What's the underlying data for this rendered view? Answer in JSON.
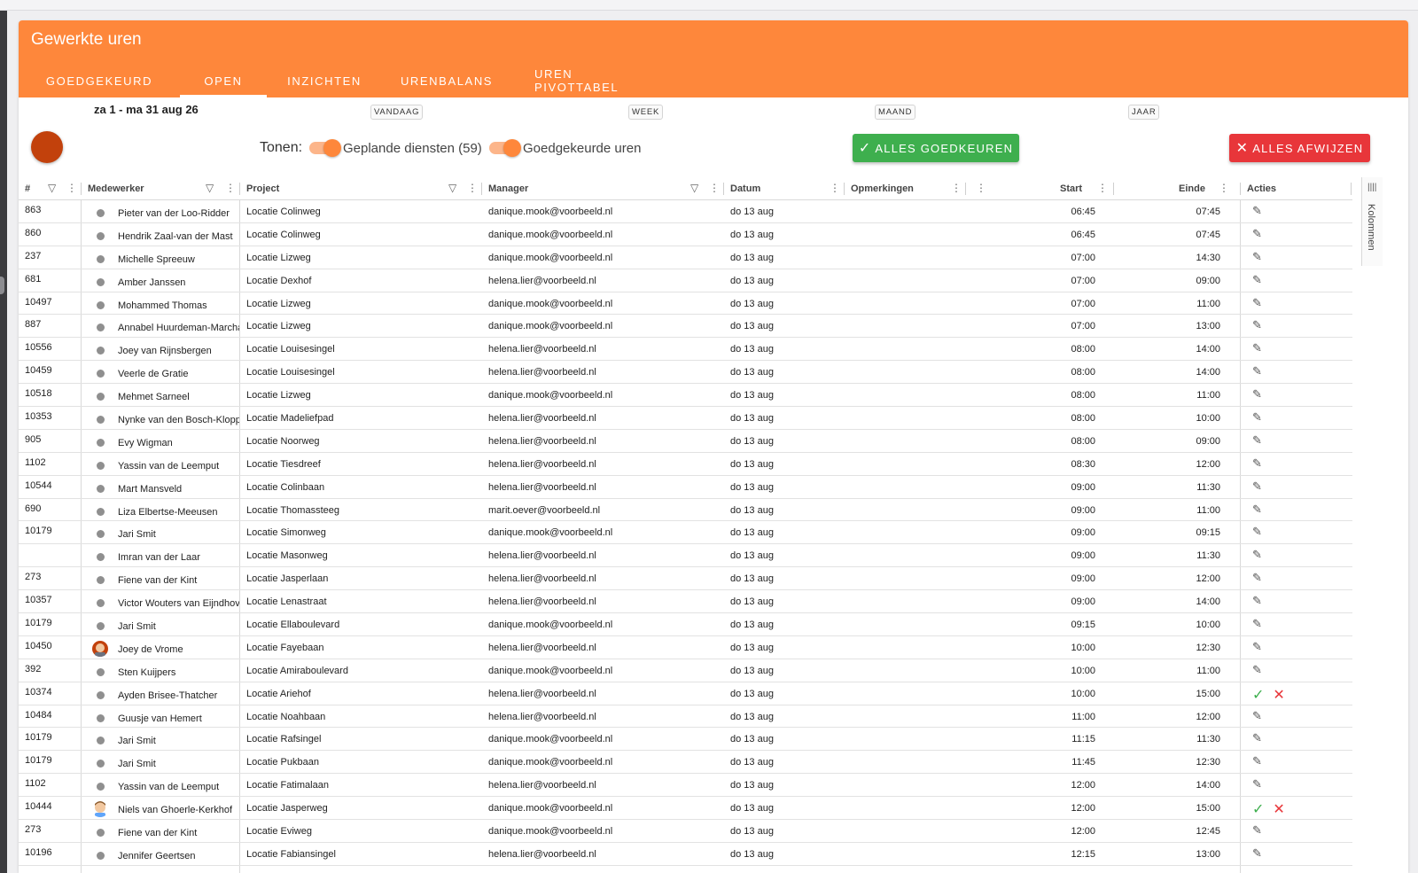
{
  "header": {
    "title": "Gewerkte uren",
    "tabs": [
      "GOEDGEKEURD",
      "OPEN",
      "INZICHTEN",
      "URENBALANS",
      "UREN PIVOTTABEL"
    ],
    "active_tab": "OPEN"
  },
  "range": {
    "label": "za 1 - ma 31 aug 26",
    "periods": [
      "VANDAAG",
      "WEEK",
      "MAAND",
      "JAAR"
    ]
  },
  "toolbar": {
    "tonen": "Tonen:",
    "toggle1": "Geplande diensten (59)",
    "toggle2": "Goedgekeurde uren",
    "approve_all": "ALLES GOEDKEUREN",
    "reject_all": "ALLES AFWIJZEN",
    "approve_icon": "✓",
    "reject_icon": "✕"
  },
  "columns": {
    "id": "#",
    "employee": "Medewerker",
    "project": "Project",
    "manager": "Manager",
    "date": "Datum",
    "remarks": "Opmerkingen",
    "start": "Start",
    "end": "Einde",
    "actions": "Acties"
  },
  "side_panel": {
    "label": "Kolommen",
    "icon": "||||"
  },
  "icons": {
    "edit": "✎",
    "approve": "✓",
    "reject": "✕"
  },
  "rows": [
    {
      "id": "863",
      "name": "Pieter van der Loo-Ridder",
      "project": "Locatie Colinweg",
      "manager": "danique.mook@voorbeeld.nl",
      "date": "do 13 aug",
      "start": "06:45",
      "end": "07:45",
      "avatar": "dot",
      "actions": "edit"
    },
    {
      "id": "860",
      "name": "Hendrik Zaal-van der Mast",
      "project": "Locatie Colinweg",
      "manager": "danique.mook@voorbeeld.nl",
      "date": "do 13 aug",
      "start": "06:45",
      "end": "07:45",
      "avatar": "dot",
      "actions": "edit"
    },
    {
      "id": "237",
      "name": "Michelle Spreeuw",
      "project": "Locatie Lizweg",
      "manager": "danique.mook@voorbeeld.nl",
      "date": "do 13 aug",
      "start": "07:00",
      "end": "14:30",
      "avatar": "dot",
      "actions": "edit"
    },
    {
      "id": "681",
      "name": "Amber Janssen",
      "project": "Locatie Dexhof",
      "manager": "helena.lier@voorbeeld.nl",
      "date": "do 13 aug",
      "start": "07:00",
      "end": "09:00",
      "avatar": "dot",
      "actions": "edit"
    },
    {
      "id": "10497",
      "name": "Mohammed Thomas",
      "project": "Locatie Lizweg",
      "manager": "danique.mook@voorbeeld.nl",
      "date": "do 13 aug",
      "start": "07:00",
      "end": "11:00",
      "avatar": "dot",
      "actions": "edit"
    },
    {
      "id": "887",
      "name": "Annabel Huurdeman-Marcha",
      "project": "Locatie Lizweg",
      "manager": "danique.mook@voorbeeld.nl",
      "date": "do 13 aug",
      "start": "07:00",
      "end": "13:00",
      "avatar": "dot",
      "actions": "edit"
    },
    {
      "id": "10556",
      "name": "Joey van Rijnsbergen",
      "project": "Locatie Louisesingel",
      "manager": "helena.lier@voorbeeld.nl",
      "date": "do 13 aug",
      "start": "08:00",
      "end": "14:00",
      "avatar": "dot",
      "actions": "edit"
    },
    {
      "id": "10459",
      "name": "Veerle de Gratie",
      "project": "Locatie Louisesingel",
      "manager": "helena.lier@voorbeeld.nl",
      "date": "do 13 aug",
      "start": "08:00",
      "end": "14:00",
      "avatar": "dot",
      "actions": "edit"
    },
    {
      "id": "10518",
      "name": "Mehmet Sarneel",
      "project": "Locatie Lizweg",
      "manager": "danique.mook@voorbeeld.nl",
      "date": "do 13 aug",
      "start": "08:00",
      "end": "11:00",
      "avatar": "dot",
      "actions": "edit"
    },
    {
      "id": "10353",
      "name": "Nynke van den Bosch-Kloppe",
      "project": "Locatie Madeliefpad",
      "manager": "helena.lier@voorbeeld.nl",
      "date": "do 13 aug",
      "start": "08:00",
      "end": "10:00",
      "avatar": "dot",
      "actions": "edit"
    },
    {
      "id": "905",
      "name": "Evy Wigman",
      "project": "Locatie Noorweg",
      "manager": "helena.lier@voorbeeld.nl",
      "date": "do 13 aug",
      "start": "08:00",
      "end": "09:00",
      "avatar": "dot",
      "actions": "edit"
    },
    {
      "id": "1102",
      "name": "Yassin van de Leemput",
      "project": "Locatie Tiesdreef",
      "manager": "helena.lier@voorbeeld.nl",
      "date": "do 13 aug",
      "start": "08:30",
      "end": "12:00",
      "avatar": "dot",
      "actions": "edit"
    },
    {
      "id": "10544",
      "name": "Mart Mansveld",
      "project": "Locatie Colinbaan",
      "manager": "helena.lier@voorbeeld.nl",
      "date": "do 13 aug",
      "start": "09:00",
      "end": "11:30",
      "avatar": "dot",
      "actions": "edit"
    },
    {
      "id": "690",
      "name": "Liza Elbertse-Meeusen",
      "project": "Locatie Thomassteeg",
      "manager": "marit.oever@voorbeeld.nl",
      "date": "do 13 aug",
      "start": "09:00",
      "end": "11:00",
      "avatar": "dot",
      "actions": "edit"
    },
    {
      "id": "10179",
      "name": "Jari Smit",
      "project": "Locatie Simonweg",
      "manager": "danique.mook@voorbeeld.nl",
      "date": "do 13 aug",
      "start": "09:00",
      "end": "09:15",
      "avatar": "dot",
      "actions": "edit"
    },
    {
      "id": "",
      "name": "Imran van der Laar",
      "project": "Locatie Masonweg",
      "manager": "helena.lier@voorbeeld.nl",
      "date": "do 13 aug",
      "start": "09:00",
      "end": "11:30",
      "avatar": "dot",
      "actions": "edit"
    },
    {
      "id": "273",
      "name": "Fiene van der Kint",
      "project": "Locatie Jasperlaan",
      "manager": "helena.lier@voorbeeld.nl",
      "date": "do 13 aug",
      "start": "09:00",
      "end": "12:00",
      "avatar": "dot",
      "actions": "edit"
    },
    {
      "id": "10357",
      "name": "Victor Wouters van Eijndhove",
      "project": "Locatie Lenastraat",
      "manager": "helena.lier@voorbeeld.nl",
      "date": "do 13 aug",
      "start": "09:00",
      "end": "14:00",
      "avatar": "dot",
      "actions": "edit"
    },
    {
      "id": "10179",
      "name": "Jari Smit",
      "project": "Locatie Ellaboulevard",
      "manager": "danique.mook@voorbeeld.nl",
      "date": "do 13 aug",
      "start": "09:15",
      "end": "10:00",
      "avatar": "dot",
      "actions": "edit"
    },
    {
      "id": "10450",
      "name": "Joey de Vrome",
      "project": "Locatie Fayebaan",
      "manager": "helena.lier@voorbeeld.nl",
      "date": "do 13 aug",
      "start": "10:00",
      "end": "12:30",
      "avatar": "face-red",
      "actions": "edit"
    },
    {
      "id": "392",
      "name": "Sten Kuijpers",
      "project": "Locatie Amiraboulevard",
      "manager": "danique.mook@voorbeeld.nl",
      "date": "do 13 aug",
      "start": "10:00",
      "end": "11:00",
      "avatar": "dot",
      "actions": "edit"
    },
    {
      "id": "10374",
      "name": "Ayden Brisee-Thatcher",
      "project": "Locatie Ariehof",
      "manager": "helena.lier@voorbeeld.nl",
      "date": "do 13 aug",
      "start": "10:00",
      "end": "15:00",
      "avatar": "dot",
      "actions": "approve-reject"
    },
    {
      "id": "10484",
      "name": "Guusje van Hemert",
      "project": "Locatie Noahbaan",
      "manager": "helena.lier@voorbeeld.nl",
      "date": "do 13 aug",
      "start": "11:00",
      "end": "12:00",
      "avatar": "dot",
      "actions": "edit"
    },
    {
      "id": "10179",
      "name": "Jari Smit",
      "project": "Locatie Rafsingel",
      "manager": "danique.mook@voorbeeld.nl",
      "date": "do 13 aug",
      "start": "11:15",
      "end": "11:30",
      "avatar": "dot",
      "actions": "edit"
    },
    {
      "id": "10179",
      "name": "Jari Smit",
      "project": "Locatie Pukbaan",
      "manager": "danique.mook@voorbeeld.nl",
      "date": "do 13 aug",
      "start": "11:45",
      "end": "12:30",
      "avatar": "dot",
      "actions": "edit"
    },
    {
      "id": "1102",
      "name": "Yassin van de Leemput",
      "project": "Locatie Fatimalaan",
      "manager": "helena.lier@voorbeeld.nl",
      "date": "do 13 aug",
      "start": "12:00",
      "end": "14:00",
      "avatar": "dot",
      "actions": "edit"
    },
    {
      "id": "10444",
      "name": "Niels van Ghoerle-Kerkhof",
      "project": "Locatie Jasperweg",
      "manager": "danique.mook@voorbeeld.nl",
      "date": "do 13 aug",
      "start": "12:00",
      "end": "15:00",
      "avatar": "face-man",
      "actions": "approve-reject"
    },
    {
      "id": "273",
      "name": "Fiene van der Kint",
      "project": "Locatie Eviweg",
      "manager": "danique.mook@voorbeeld.nl",
      "date": "do 13 aug",
      "start": "12:00",
      "end": "12:45",
      "avatar": "dot",
      "actions": "edit"
    },
    {
      "id": "10196",
      "name": "Jennifer Geertsen",
      "project": "Locatie Fabiansingel",
      "manager": "helena.lier@voorbeeld.nl",
      "date": "do 13 aug",
      "start": "12:15",
      "end": "13:00",
      "avatar": "dot",
      "actions": "edit"
    }
  ],
  "colors": {
    "brand_orange": "#fe873b",
    "approve_green": "#3eaf4e",
    "reject_red": "#e8363a"
  }
}
